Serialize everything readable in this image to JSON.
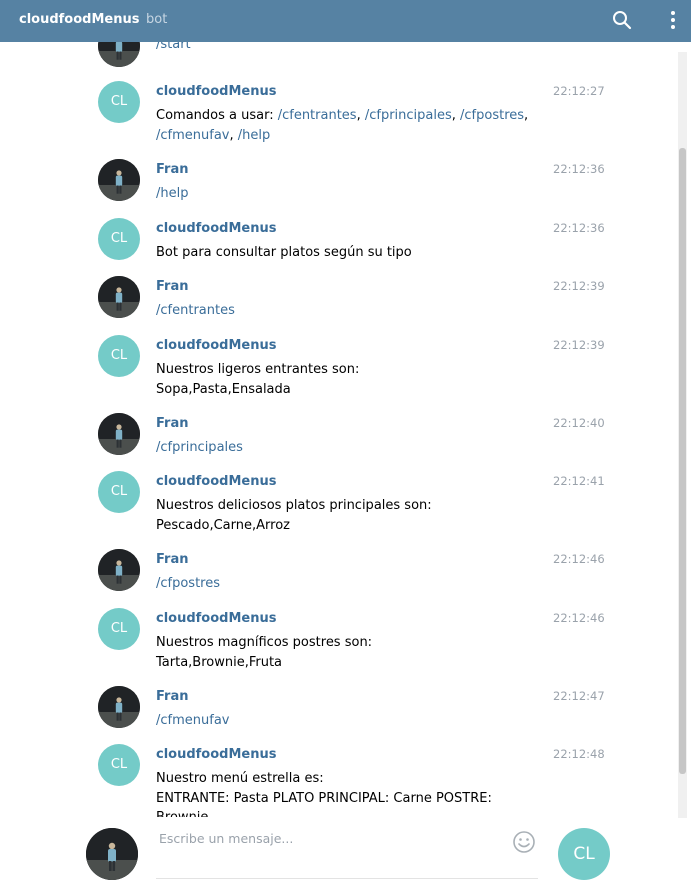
{
  "header": {
    "title": "cloudfoodMenus",
    "subtitle": "bot",
    "search_icon": "search-icon",
    "menu_icon": "more-vertical-icon"
  },
  "colors": {
    "header_bg": "#5682a3",
    "link": "#3a6d99",
    "bot_avatar": "#74cbc8",
    "time": "#9aa2ab"
  },
  "messages": [
    {
      "sender": "",
      "time": "",
      "avatar": "photo",
      "parts": [
        {
          "t": "/start",
          "link": true
        }
      ]
    },
    {
      "sender": "cloudfoodMenus",
      "time": "22:12:27",
      "avatar": "CL",
      "parts": [
        {
          "t": "Comandos a usar: ",
          "link": false
        },
        {
          "t": "/cfentrantes",
          "link": true
        },
        {
          "t": ", ",
          "link": false
        },
        {
          "t": "/cfprincipales",
          "link": true
        },
        {
          "t": ", ",
          "link": false
        },
        {
          "t": "/cfpostres",
          "link": true
        },
        {
          "t": ", ",
          "link": false
        },
        {
          "t": "/cfmenufav",
          "link": true
        },
        {
          "t": ", ",
          "link": false
        },
        {
          "t": "/help",
          "link": true
        }
      ]
    },
    {
      "sender": "Fran",
      "time": "22:12:36",
      "avatar": "photo",
      "parts": [
        {
          "t": "/help",
          "link": true
        }
      ]
    },
    {
      "sender": "cloudfoodMenus",
      "time": "22:12:36",
      "avatar": "CL",
      "parts": [
        {
          "t": "Bot para consultar platos según su tipo",
          "link": false
        }
      ]
    },
    {
      "sender": "Fran",
      "time": "22:12:39",
      "avatar": "photo",
      "parts": [
        {
          "t": "/cfentrantes",
          "link": true
        }
      ]
    },
    {
      "sender": "cloudfoodMenus",
      "time": "22:12:39",
      "avatar": "CL",
      "parts": [
        {
          "t": "Nuestros ligeros entrantes son:\nSopa,Pasta,Ensalada",
          "link": false
        }
      ]
    },
    {
      "sender": "Fran",
      "time": "22:12:40",
      "avatar": "photo",
      "parts": [
        {
          "t": "/cfprincipales",
          "link": true
        }
      ]
    },
    {
      "sender": "cloudfoodMenus",
      "time": "22:12:41",
      "avatar": "CL",
      "parts": [
        {
          "t": "Nuestros deliciosos platos principales son:\nPescado,Carne,Arroz",
          "link": false
        }
      ]
    },
    {
      "sender": "Fran",
      "time": "22:12:46",
      "avatar": "photo",
      "parts": [
        {
          "t": "/cfpostres",
          "link": true
        }
      ]
    },
    {
      "sender": "cloudfoodMenus",
      "time": "22:12:46",
      "avatar": "CL",
      "parts": [
        {
          "t": "Nuestros magníficos postres son:\nTarta,Brownie,Fruta",
          "link": false
        }
      ]
    },
    {
      "sender": "Fran",
      "time": "22:12:47",
      "avatar": "photo",
      "parts": [
        {
          "t": "/cfmenufav",
          "link": true
        }
      ]
    },
    {
      "sender": "cloudfoodMenus",
      "time": "22:12:48",
      "avatar": "CL",
      "parts": [
        {
          "t": "Nuestro menú estrella es:\nENTRANTE: Pasta PLATO PRINCIPAL: Carne POSTRE:\nBrownie",
          "link": false
        }
      ]
    }
  ],
  "composer": {
    "placeholder": "Escribe un mensaje...",
    "emoji_icon": "smiley-icon",
    "send_avatar_label": "CL"
  }
}
